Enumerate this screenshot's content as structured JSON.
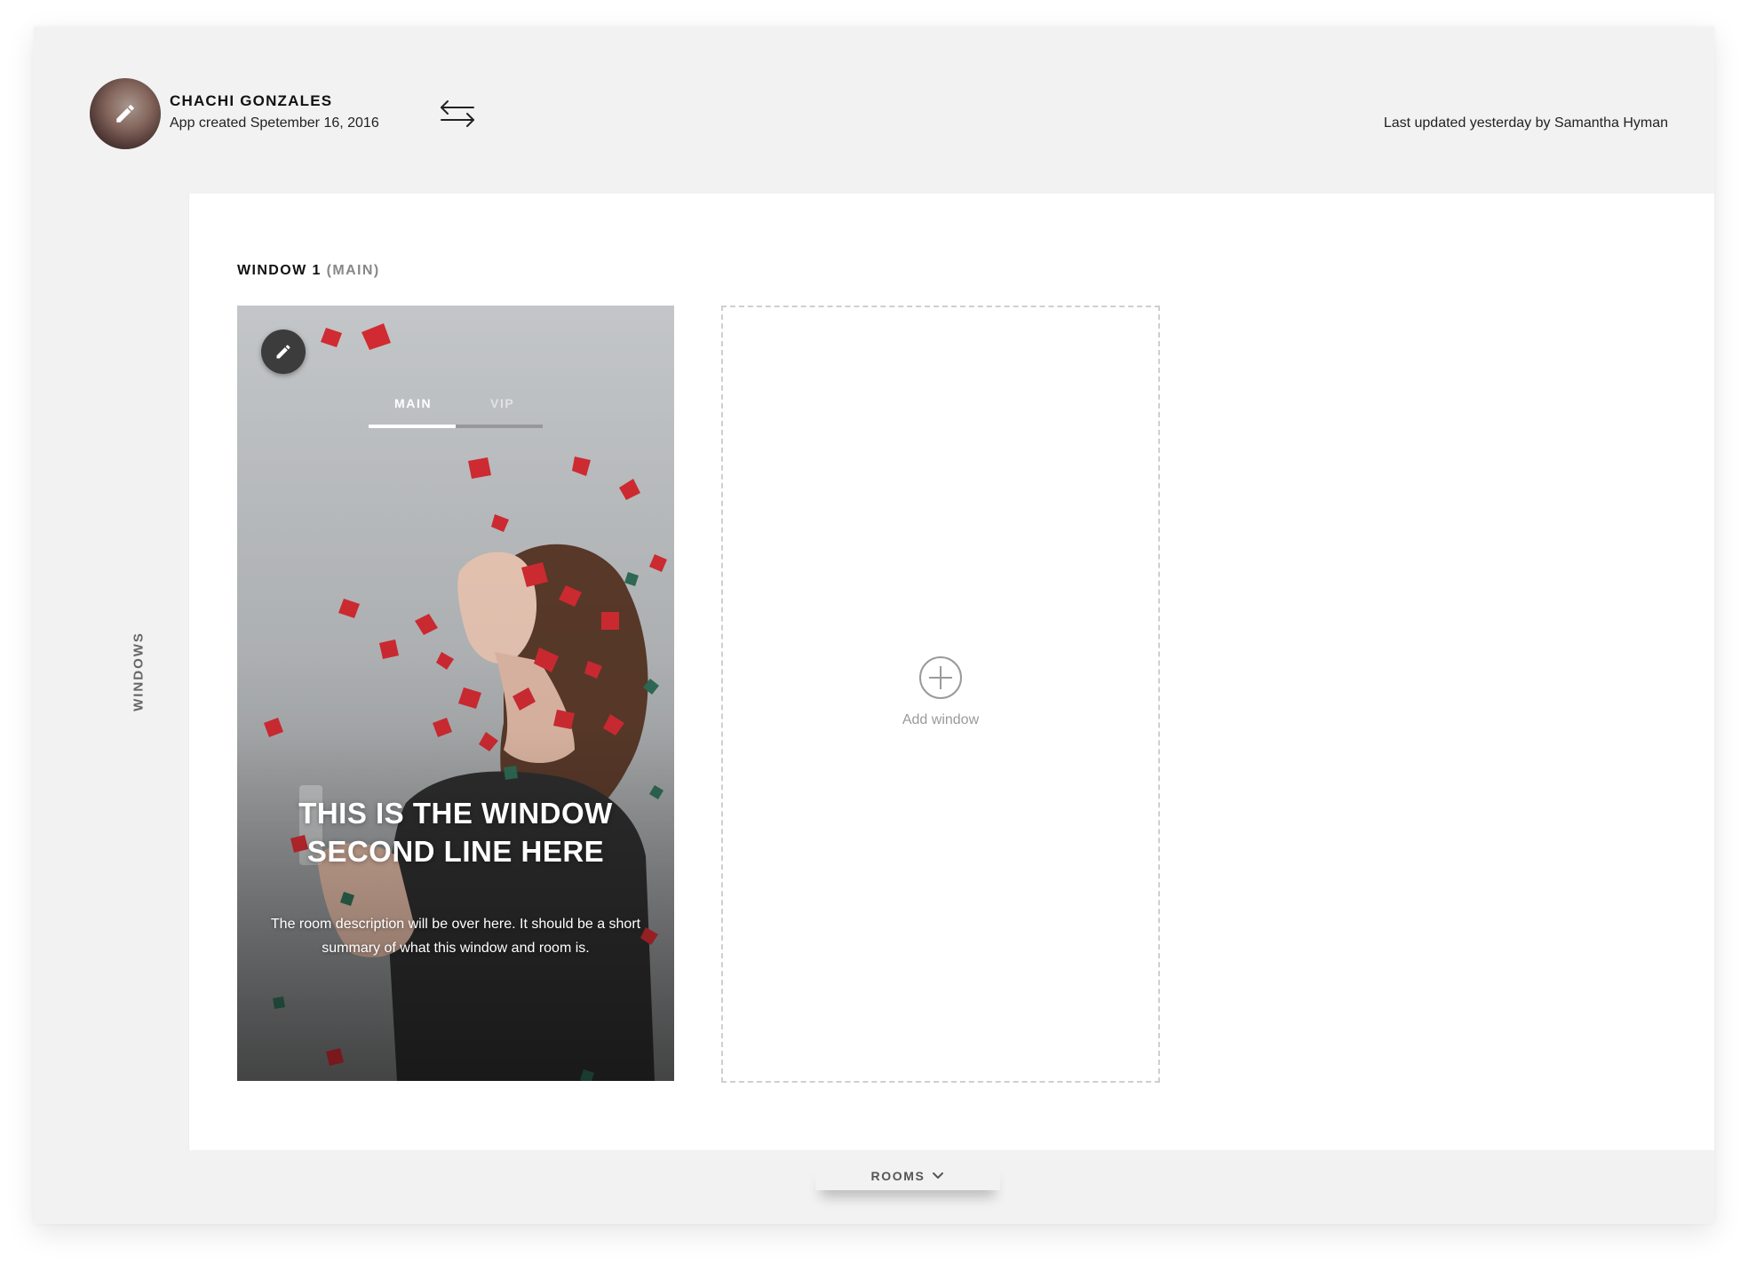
{
  "header": {
    "user_name": "CHACHI GONZALES",
    "app_created": "App created Spetember 16, 2016",
    "last_updated": "Last updated yesterday by Samantha Hyman"
  },
  "sidebar": {
    "label": "WINDOWS"
  },
  "window": {
    "heading": "WINDOW 1",
    "heading_tag": "(MAIN)",
    "tabs": [
      {
        "label": "MAIN",
        "active": true
      },
      {
        "label": "VIP",
        "active": false
      }
    ],
    "title_line1": "THIS IS THE WINDOW",
    "title_line2": "SECOND LINE HERE",
    "description": "The room description will be over here. It should be a short summary of what this window and room is."
  },
  "add_window": {
    "label": "Add window"
  },
  "footer": {
    "rooms_label": "ROOMS"
  },
  "icons": {
    "avatar_edit": "pencil-icon",
    "swap": "swap-arrows-icon",
    "card_edit": "pencil-icon",
    "add": "plus-circle-icon",
    "rooms_toggle": "chevron-down-icon"
  },
  "colors": {
    "frame_bg": "#f2f2f2",
    "panel_bg": "#ffffff",
    "text_primary": "#111111",
    "text_muted": "#888888",
    "dashed_border": "#cfcfcf",
    "confetti_red": "#d12b32"
  }
}
